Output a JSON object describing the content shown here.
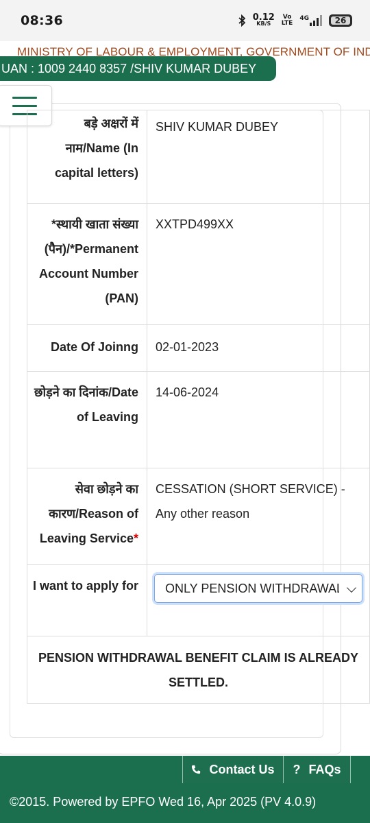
{
  "status_bar": {
    "time": "08:36",
    "speed_value": "0.12",
    "speed_unit": "KB/S",
    "volte_top": "Vo",
    "volte_bottom": "LTE",
    "network": "4G",
    "battery": "26"
  },
  "header": {
    "ministry": "MINISTRY OF LABOUR & EMPLOYMENT, GOVERNMENT OF INDIA",
    "uan": "UAN : 1009 2440 8357 /SHIV KUMAR DUBEY"
  },
  "form": {
    "rows": [
      {
        "label": "बड़े अक्षरों में नाम/Name (In capital letters)",
        "value": "SHIV KUMAR DUBEY"
      },
      {
        "label": "*स्थायी खाता संख्या (पैन)/*Permanent Account Number (PAN)",
        "value": "XXTPD499XX"
      },
      {
        "label": "Date Of Joinng",
        "value": "02-01-2023"
      },
      {
        "label": "छोड़ने का दिनांक/Date of Leaving",
        "value": "14-06-2024"
      },
      {
        "label": "सेवा छोड़ने का कारण/Reason of Leaving Service",
        "required_mark": "*",
        "value": "CESSATION (SHORT SERVICE) - Any other reason"
      }
    ],
    "apply_label": "I want to apply for",
    "apply_selected": "ONLY PENSION WITHDRAWAL",
    "message": "PENSION WITHDRAWAL BENEFIT CLAIM IS ALREADY SETTLED."
  },
  "footer": {
    "contact": "Contact Us",
    "faq_icon": "?",
    "faq": "FAQs",
    "copyright": "©2015. Powered by EPFO Wed 16, Apr 2025 (PV 4.0.9)"
  },
  "colors": {
    "brand_green": "#1b6e4e",
    "ministry_text": "#a04a1e",
    "required": "#d00000"
  },
  "icons": [
    "bluetooth-icon",
    "signal-icon",
    "battery-icon",
    "menu-icon",
    "phone-icon",
    "question-icon",
    "chevron-down-icon"
  ]
}
